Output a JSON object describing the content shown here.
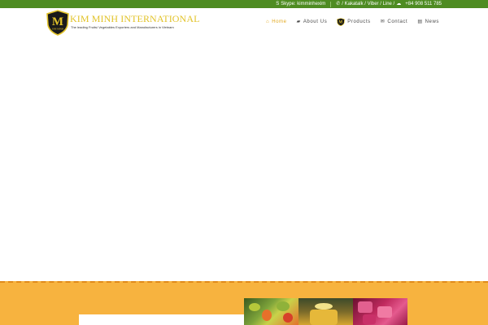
{
  "topbar": {
    "skype": "Skype: kimminhexim",
    "messaging": "/ Kakatalk / Viber / Line /",
    "phone": "+84 908 511 785"
  },
  "brand": {
    "name": "KIM MINH INTERNATIONAL",
    "tagline": "The leading Fruits/ Vegetables Exporters and Manufacturers in Vietnam",
    "badge_letter": "M",
    "badge_text": "KIM MINH"
  },
  "nav": {
    "items": [
      {
        "label": "Home",
        "icon": "home-icon",
        "active": true
      },
      {
        "label": "About Us",
        "icon": "briefcase-icon",
        "active": false
      },
      {
        "label": "Products",
        "icon": "logo-badge-icon",
        "active": false
      },
      {
        "label": "Contact",
        "icon": "envelope-icon",
        "active": false
      },
      {
        "label": "News",
        "icon": "newspaper-icon",
        "active": false
      }
    ]
  },
  "colors": {
    "topbar": "#4e8c22",
    "accent": "#e2a81e",
    "brand": "#e2c32a",
    "band": "#f7b33f"
  }
}
